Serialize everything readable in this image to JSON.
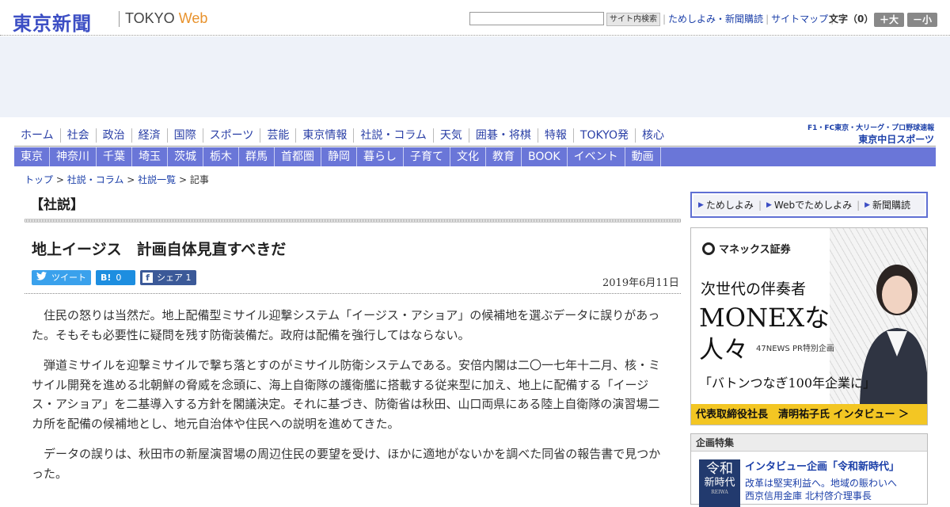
{
  "header": {
    "logo_jp": "東京新聞",
    "logo_en": "TOKYO",
    "logo_web": "Web",
    "search_placeholder": "",
    "search_button": "サイト内検索",
    "links": [
      "ためしよみ・新聞購読",
      "サイトマップ"
    ],
    "font_size_label": "文字（0）",
    "font_bigger": "＋大",
    "font_smaller": "－小"
  },
  "nav": {
    "primary": [
      "ホーム",
      "社会",
      "政治",
      "経済",
      "国際",
      "スポーツ",
      "芸能",
      "東京情報",
      "社説・コラム",
      "天気",
      "囲碁・将棋",
      "特報",
      "TOKYO発",
      "核心"
    ],
    "secondary": [
      "東京",
      "神奈川",
      "千葉",
      "埼玉",
      "茨城",
      "栃木",
      "群馬",
      "首都圏",
      "静岡",
      "暮らし",
      "子育て",
      "文化",
      "教育",
      "BOOK",
      "イベント",
      "動画"
    ],
    "chunichi_sub": "F1・FC東京・大リーグ・プロ野球速報",
    "chunichi_main": "東京中日スポーツ"
  },
  "breadcrumb": [
    "トップ",
    "社説・コラム",
    "社説一覧",
    "記事"
  ],
  "article": {
    "section": "【社説】",
    "headline": "地上イージス　計画自体見直すべきだ",
    "tweet_label": "ツイート",
    "hatena_count": "0",
    "share_label": "シェア",
    "share_count": "1",
    "date": "2019年6月11日",
    "paragraphs": [
      "住民の怒りは当然だ。地上配備型ミサイル迎撃システム「イージス・アショア」の候補地を選ぶデータに誤りがあった。そもそも必要性に疑問を残す防衛装備だ。政府は配備を強行してはならない。",
      "弾道ミサイルを迎撃ミサイルで撃ち落とすのがミサイル防衛システムである。安倍内閣は二〇一七年十二月、核・ミサイル開発を進める北朝鮮の脅威を念頭に、海上自衛隊の護衛艦に搭載する従来型に加え、地上に配備する「イージス・アショア」を二基導入する方針を閣議決定。それに基づき、防衛省は秋田、山口両県にある陸上自衛隊の演習場二カ所を配備の候補地とし、地元自治体や住民への説明を進めてきた。",
      "データの誤りは、秋田市の新屋演習場の周辺住民の要望を受け、ほかに適地がないかを調べた同省の報告書で見つかった。"
    ]
  },
  "sidebar": {
    "subscribe": [
      "ためしよみ",
      "Webでためしよみ",
      "新聞購読"
    ],
    "ad": {
      "brand": "マネックス証券",
      "line1": "次世代の伴奏者",
      "line2": "MONEXな",
      "line3": "人々",
      "tag": "47NEWS PR特別企画",
      "line4": "「バトンつなぎ100年企業に」",
      "bottom": "代表取締役社長　清明祐子氏 インタビュー ＞"
    },
    "kikaku": {
      "heading": "企画特集",
      "thumb_a": "令和",
      "thumb_b": "新時代",
      "thumb_c": "REIWA",
      "title": "インタビュー企画「令和新時代」",
      "desc1": "改革は堅実利益へ。地域の賑わいへ",
      "desc2": "西京信用金庫 北村啓介理事長"
    }
  }
}
